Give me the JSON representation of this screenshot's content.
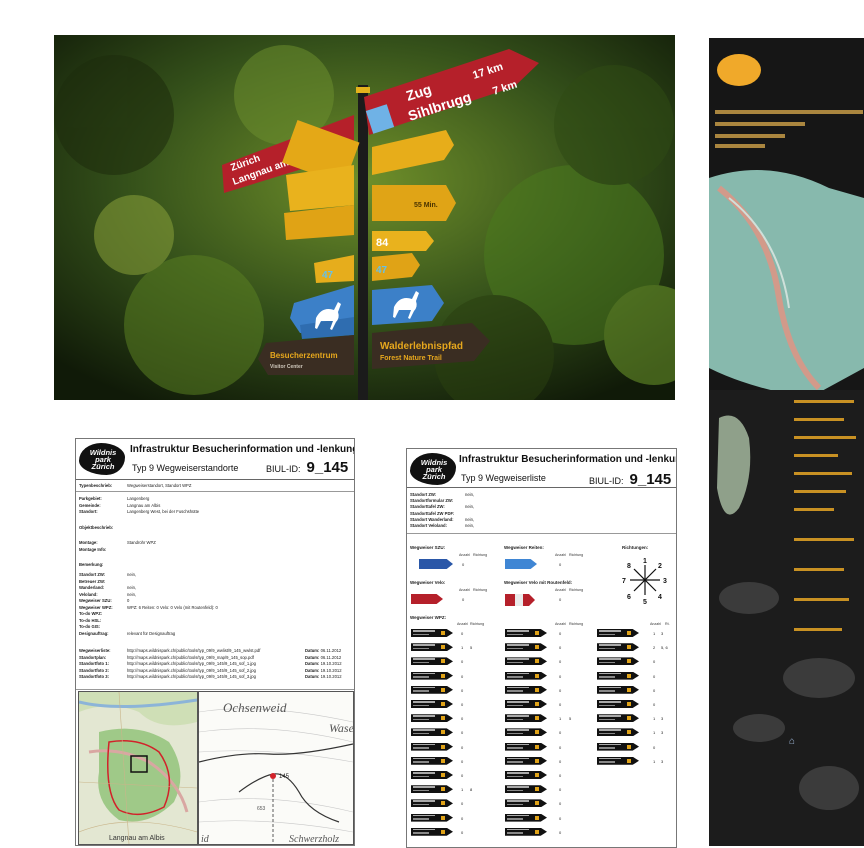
{
  "photo": {
    "signs": {
      "top_red": {
        "dest1": "Zug",
        "dist1": "17 km",
        "dest2": "Sihlbrugg",
        "dist2": "7 km"
      },
      "left_red": {
        "dest1": "Zürich",
        "dest2": "Langnau am Albis"
      },
      "brown_left": {
        "line1": "Besucherzentrum",
        "line2": "Visitor Center"
      },
      "brown_right": {
        "line1": "Walderlebnispfad",
        "line2": "Forest Nature Trail"
      },
      "yellow_codes": [
        "84",
        "47",
        "84",
        "47"
      ],
      "yellow_time": "55 Min."
    }
  },
  "doc1": {
    "logo": {
      "line1": "Wildnis",
      "line2": "park",
      "line3": "Zürich"
    },
    "title": "Infrastruktur Besucherinformation und -lenkung",
    "subtitle": "Typ 9 Wegweiserstandorte",
    "biul_label": "BIUL-ID:",
    "biul_id": "9_145",
    "typ_label": "Typenbeschrieb:",
    "typ_value": "Wegweiserstandort, Standort WPZ",
    "fields_a": [
      {
        "label": "Parkgebiet:",
        "value": "Langenberg"
      },
      {
        "label": "Gemeinde:",
        "value": "Langnau am Albis"
      },
      {
        "label": "Standort:",
        "value": "Langenberg West, bei der Fuschshütte"
      }
    ],
    "objekt_label": "Objektbeschrieb:",
    "fields_b": [
      {
        "label": "Montage:",
        "value": "Standrohr WPZ"
      },
      {
        "label": "Montage Info:",
        "value": ""
      }
    ],
    "bem_label": "Bemerkung:",
    "fields_c": [
      {
        "label": "Standort ZW:",
        "value": "nein,"
      },
      {
        "label": "Betreuer ZW:",
        "value": ""
      },
      {
        "label": "Wanderland:",
        "value": "nein,"
      },
      {
        "label": "Veloland:",
        "value": "nein,"
      },
      {
        "label": "Wegweiser SZU:",
        "value": "0"
      },
      {
        "label": "Wegweiser WPZ:",
        "value": "WPZ: 6        Reiten: 0        Velo: 0        Velo (mit Routenfeld): 0"
      },
      {
        "label": "To-do WPZ:",
        "value": ""
      },
      {
        "label": "To-do HSL:",
        "value": ""
      },
      {
        "label": "To-do GIS:",
        "value": ""
      },
      {
        "label": "Designauftrag:",
        "value": "relevant für Designauftrag"
      }
    ],
    "links": [
      {
        "label": "Wegweiserliste:",
        "value": "http://maps.wildnispark.ch/public/tools/typ_09/9_wwlist/9_145_wwlst.pdf",
        "date": "06.11.2012"
      },
      {
        "label": "Standortplan:",
        "value": "http://maps.wildnispark.ch/public/tools/typ_09/9_map/9_145_sop.pdf",
        "date": "06.11.2012"
      },
      {
        "label": "Standortfoto 1:",
        "value": "http://maps.wildnispark.ch/public/tools/typ_09/9_145/9_145_sof_1.jpg",
        "date": "19.10.2012"
      },
      {
        "label": "Standortfoto 2:",
        "value": "http://maps.wildnispark.ch/public/tools/typ_09/9_145/9_145_sof_2.jpg",
        "date": "19.10.2012"
      },
      {
        "label": "Standortfoto 3:",
        "value": "http://maps.wildnispark.ch/public/tools/typ_09/9_145/9_145_sof_3.jpg",
        "date": "19.10.2012"
      }
    ],
    "date_label": "Datum:",
    "map_right": {
      "place1": "Ochsenweid",
      "place2": "Wase",
      "place3": "Schwerzholz",
      "marker": "145",
      "place4": "id",
      "elev": "653"
    },
    "map_left": {
      "place": "Langnau am Albis"
    }
  },
  "doc2": {
    "logo": {
      "line1": "Wildnis",
      "line2": "park",
      "line3": "Zürich"
    },
    "title": "Infrastruktur Besucherinformation und -lenkung",
    "subtitle": "Typ 9 Wegweiserliste",
    "biul_label": "BIUL-ID:",
    "biul_id": "9_145",
    "fields": [
      {
        "label": "Standort ZW:",
        "value": "nein,"
      },
      {
        "label": "Standortformular ZW:",
        "value": ""
      },
      {
        "label": "Standorttafel ZW:",
        "value": "nein,"
      },
      {
        "label": "Standorttafel ZW PDF:",
        "value": ""
      },
      {
        "label": "Standort Wanderland:",
        "value": "nein,"
      },
      {
        "label": "Standort Veloland:",
        "value": "nein,"
      }
    ],
    "sec_szu": "Wegweiser SZU:",
    "sec_reiten": "Wegweiser Reiten:",
    "sec_richtungen": "Richtungen:",
    "sec_velo": "Wegweiser Velo:",
    "sec_velo_route": "Wegweiser Velo mit Routenfeld:",
    "sec_wpz": "Wegweiser WPZ:",
    "col_anzahl": "Anzahl",
    "col_richtung": "Richtung",
    "col_rt": "Rt.",
    "szu_anzahl": "0",
    "reiten_anzahl": "0",
    "velo_anzahl": "0",
    "velo_route_anzahl": "0",
    "compass": [
      "1",
      "2",
      "3",
      "4",
      "5",
      "6",
      "7",
      "8"
    ],
    "wpz_col1": [
      {
        "a": "0",
        "r": ""
      },
      {
        "a": "1",
        "r": "5"
      },
      {
        "a": "0",
        "r": ""
      },
      {
        "a": "0",
        "r": ""
      },
      {
        "a": "0",
        "r": ""
      },
      {
        "a": "0",
        "r": ""
      },
      {
        "a": "0",
        "r": ""
      },
      {
        "a": "0",
        "r": ""
      },
      {
        "a": "0",
        "r": ""
      },
      {
        "a": "0",
        "r": ""
      },
      {
        "a": "0",
        "r": ""
      },
      {
        "a": "1",
        "r": "8"
      },
      {
        "a": "0",
        "r": ""
      },
      {
        "a": "0",
        "r": ""
      },
      {
        "a": "0",
        "r": ""
      }
    ],
    "wpz_col2": [
      {
        "a": "0",
        "r": ""
      },
      {
        "a": "0",
        "r": ""
      },
      {
        "a": "0",
        "r": ""
      },
      {
        "a": "0",
        "r": ""
      },
      {
        "a": "0",
        "r": ""
      },
      {
        "a": "0",
        "r": ""
      },
      {
        "a": "1",
        "r": "5"
      },
      {
        "a": "0",
        "r": ""
      },
      {
        "a": "0",
        "r": ""
      },
      {
        "a": "0",
        "r": ""
      },
      {
        "a": "0",
        "r": ""
      },
      {
        "a": "0",
        "r": ""
      },
      {
        "a": "0",
        "r": ""
      },
      {
        "a": "0",
        "r": ""
      },
      {
        "a": "0",
        "r": ""
      }
    ],
    "wpz_col3": [
      {
        "a": "1",
        "r": "3"
      },
      {
        "a": "2",
        "r": "5, 6"
      },
      {
        "a": "0",
        "r": ""
      },
      {
        "a": "0",
        "r": ""
      },
      {
        "a": "0",
        "r": ""
      },
      {
        "a": "0",
        "r": ""
      },
      {
        "a": "1",
        "r": "3"
      },
      {
        "a": "1",
        "r": "3"
      },
      {
        "a": "0",
        "r": ""
      },
      {
        "a": "1",
        "r": "3"
      }
    ]
  }
}
